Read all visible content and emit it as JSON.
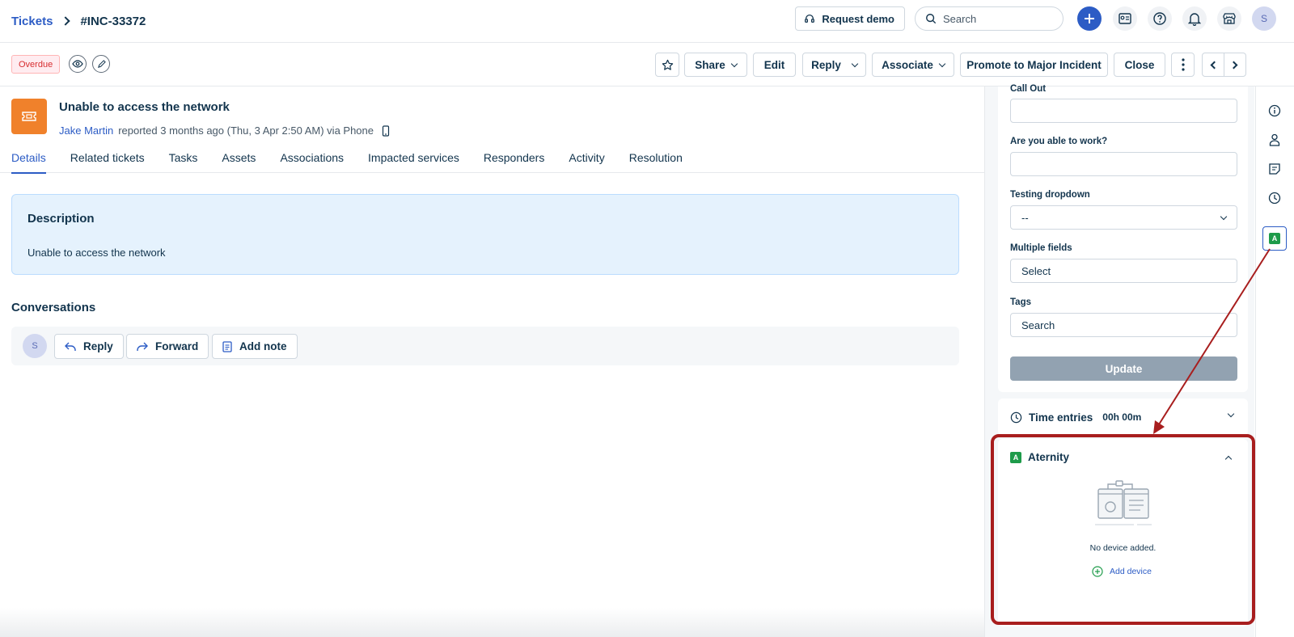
{
  "breadcrumb": {
    "root": "Tickets",
    "current": "#INC-33372"
  },
  "topbar": {
    "request_demo": "Request demo",
    "search_placeholder": "Search",
    "avatar_initial": "S"
  },
  "actionbar": {
    "status_badge": "Overdue",
    "buttons": {
      "share": "Share",
      "edit": "Edit",
      "reply": "Reply",
      "associate": "Associate",
      "promote": "Promote to Major Incident",
      "close": "Close"
    }
  },
  "ticket": {
    "title": "Unable to access the network",
    "requester": "Jake Martin",
    "meta": "reported 3 months ago (Thu, 3 Apr 2:50 AM) via Phone"
  },
  "tabs": [
    "Details",
    "Related tickets",
    "Tasks",
    "Assets",
    "Associations",
    "Impacted services",
    "Responders",
    "Activity",
    "Resolution"
  ],
  "description": {
    "title": "Description",
    "text": "Unable to access the network"
  },
  "conversations": {
    "title": "Conversations",
    "avatar_initial": "S",
    "reply": "Reply",
    "forward": "Forward",
    "add_note": "Add note"
  },
  "properties": {
    "call_out_label": "Call Out",
    "able_to_work_label": "Are you able to work?",
    "testing_dropdown_label": "Testing dropdown",
    "testing_dropdown_value": "--",
    "multiple_fields_label": "Multiple fields",
    "multiple_fields_value": "Select",
    "tags_label": "Tags",
    "tags_placeholder": "Search",
    "update_button": "Update"
  },
  "time_entries": {
    "label": "Time entries",
    "value": "00h 00m"
  },
  "aternity": {
    "badge": "A",
    "title": "Aternity",
    "empty_text": "No device added.",
    "add_device": "Add device"
  },
  "colors": {
    "primary": "#2c5cc5",
    "ticket_icon": "#f0812b",
    "overdue": "#d72d30",
    "aternity_green": "#1e9b4a",
    "highlight_red": "#a81e1e",
    "update_disabled": "#92a2b1"
  }
}
